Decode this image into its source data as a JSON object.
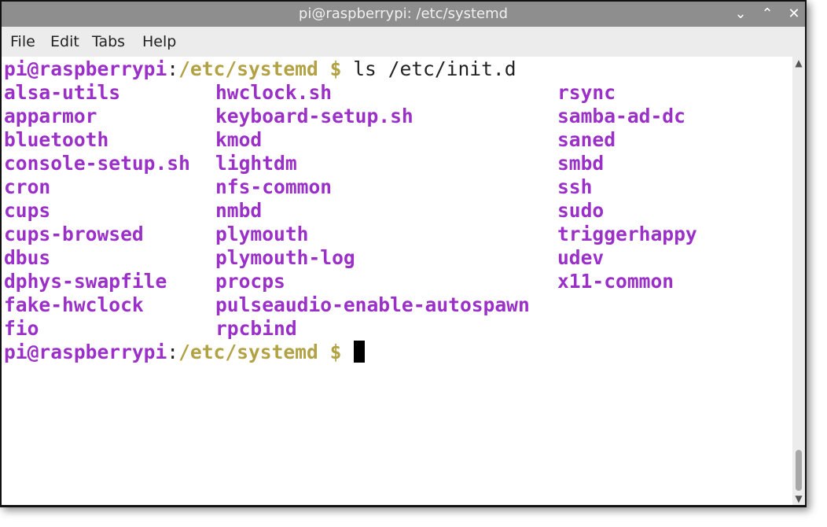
{
  "window": {
    "title": "pi@raspberrypi: /etc/systemd",
    "controls": {
      "minimize": "⌄",
      "maximize": "⌃",
      "close": "✕"
    }
  },
  "menu": [
    "File",
    "Edit",
    "Tabs",
    "Help"
  ],
  "terminal": {
    "prompt_user": "pi@raspberrypi",
    "prompt_sep": ":",
    "prompt_path": "/etc/systemd $",
    "command": " ls /etc/init.d",
    "listing": [
      [
        "alsa-utils",
        "hwclock.sh",
        "rsync"
      ],
      [
        "apparmor",
        "keyboard-setup.sh",
        "samba-ad-dc"
      ],
      [
        "bluetooth",
        "kmod",
        "saned"
      ],
      [
        "console-setup.sh",
        "lightdm",
        "smbd"
      ],
      [
        "cron",
        "nfs-common",
        "ssh"
      ],
      [
        "cups",
        "nmbd",
        "sudo"
      ],
      [
        "cups-browsed",
        "plymouth",
        "triggerhappy"
      ],
      [
        "dbus",
        "plymouth-log",
        "udev"
      ],
      [
        "dphys-swapfile",
        "procps",
        "x11-common"
      ],
      [
        "fake-hwclock",
        "pulseaudio-enable-autospawn",
        ""
      ],
      [
        "fio",
        "rpcbind",
        ""
      ]
    ]
  },
  "colors": {
    "directory_entry": "#9b30c8",
    "prompt_user": "#9b30c8",
    "prompt_path": "#b2a244",
    "titlebar": "#8e8e8e"
  },
  "icons": {
    "scroll_up": "up-arrow-icon",
    "scroll_down": "down-arrow-icon"
  }
}
